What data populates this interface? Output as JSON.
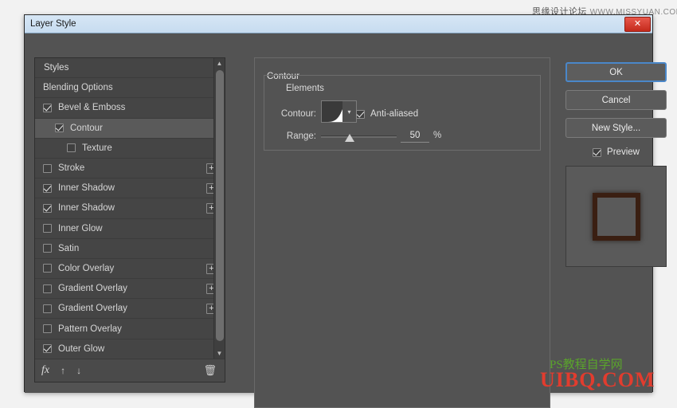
{
  "window": {
    "title": "Layer Style",
    "close_label": "✕"
  },
  "styles_panel": {
    "header": "Styles",
    "items": [
      {
        "label": "Blending Options",
        "checkbox": "none",
        "checked": false,
        "indent": 0,
        "plus": false,
        "selected": false
      },
      {
        "label": "Bevel & Emboss",
        "checkbox": "visible",
        "checked": true,
        "indent": 0,
        "plus": false,
        "selected": false
      },
      {
        "label": "Contour",
        "checkbox": "visible",
        "checked": true,
        "indent": 1,
        "plus": false,
        "selected": true
      },
      {
        "label": "Texture",
        "checkbox": "visible",
        "checked": false,
        "indent": 2,
        "plus": false,
        "selected": false
      },
      {
        "label": "Stroke",
        "checkbox": "visible",
        "checked": false,
        "indent": 0,
        "plus": true,
        "selected": false
      },
      {
        "label": "Inner Shadow",
        "checkbox": "visible",
        "checked": true,
        "indent": 0,
        "plus": true,
        "selected": false
      },
      {
        "label": "Inner Shadow",
        "checkbox": "visible",
        "checked": true,
        "indent": 0,
        "plus": true,
        "selected": false
      },
      {
        "label": "Inner Glow",
        "checkbox": "visible",
        "checked": false,
        "indent": 0,
        "plus": false,
        "selected": false
      },
      {
        "label": "Satin",
        "checkbox": "visible",
        "checked": false,
        "indent": 0,
        "plus": false,
        "selected": false
      },
      {
        "label": "Color Overlay",
        "checkbox": "visible",
        "checked": false,
        "indent": 0,
        "plus": true,
        "selected": false
      },
      {
        "label": "Gradient Overlay",
        "checkbox": "visible",
        "checked": false,
        "indent": 0,
        "plus": true,
        "selected": false
      },
      {
        "label": "Gradient Overlay",
        "checkbox": "visible",
        "checked": false,
        "indent": 0,
        "plus": true,
        "selected": false
      },
      {
        "label": "Pattern Overlay",
        "checkbox": "visible",
        "checked": false,
        "indent": 0,
        "plus": false,
        "selected": false
      },
      {
        "label": "Outer Glow",
        "checkbox": "visible",
        "checked": true,
        "indent": 0,
        "plus": false,
        "selected": false
      }
    ],
    "footer": {
      "fx_label": "fx",
      "up_arrow": "↑",
      "down_arrow": "↓",
      "trash": "🗑"
    },
    "scroll": {
      "up_arrow": "▲",
      "down_arrow": "▼"
    }
  },
  "center_panel": {
    "section_title": "Contour",
    "group_title": "Elements",
    "contour_label": "Contour:",
    "antialiased_label": "Anti-aliased",
    "antialiased_checked": true,
    "range_label": "Range:",
    "range_value": "50",
    "range_unit": "%",
    "dropdown_arrow": "▾"
  },
  "buttons": {
    "ok": "OK",
    "cancel": "Cancel",
    "new_style": "New Style...",
    "preview": "Preview",
    "preview_checked": true
  },
  "watermarks": {
    "top_cn": "思缘设计论坛",
    "top_en": "WWW.MISSYUAN.COM",
    "bottom_red": "UIBQ.COM",
    "bottom_green": "PS教程自学网"
  }
}
